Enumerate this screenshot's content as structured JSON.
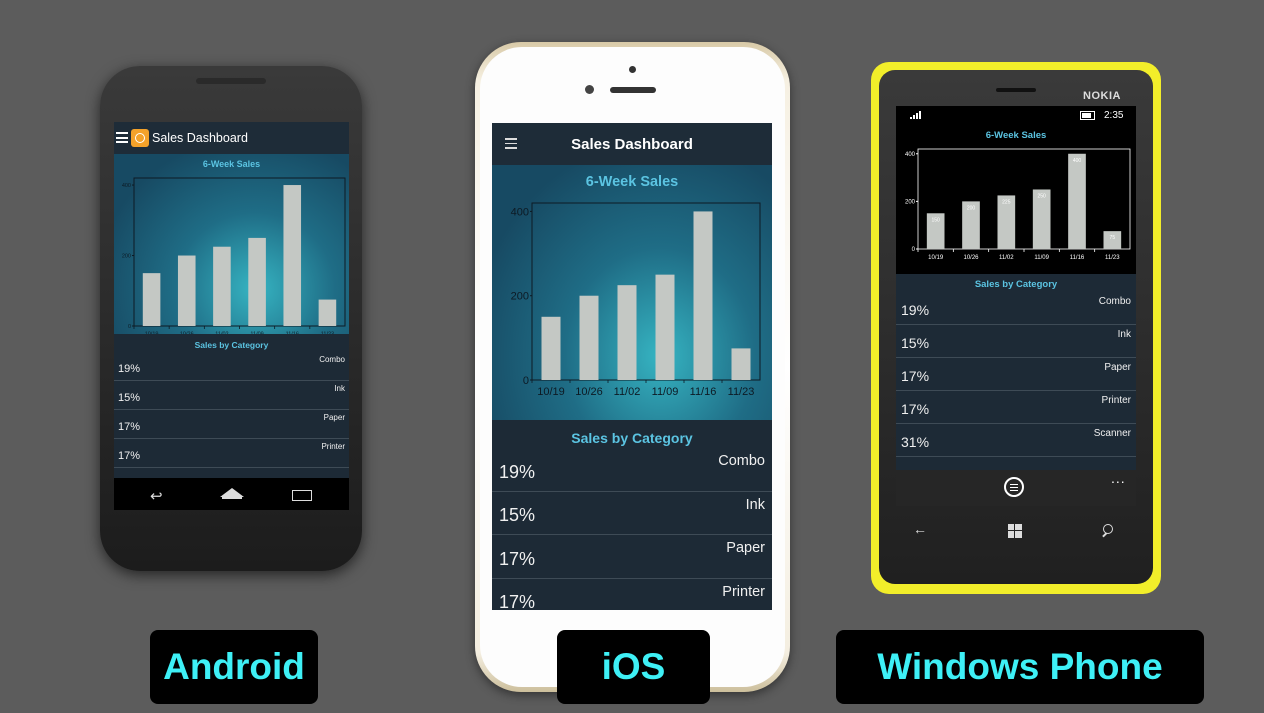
{
  "app": {
    "title": "Sales Dashboard"
  },
  "chart_data": {
    "type": "bar",
    "title": "6-Week Sales",
    "categories": [
      "10/19",
      "10/26",
      "11/02",
      "11/09",
      "11/16",
      "11/23"
    ],
    "values": [
      150,
      200,
      225,
      250,
      400,
      75
    ],
    "ylim": [
      0,
      420
    ],
    "yticks": [
      0,
      200,
      400
    ]
  },
  "category_section": {
    "title": "Sales by Category"
  },
  "categories": [
    {
      "pct": "19%",
      "name": "Combo"
    },
    {
      "pct": "15%",
      "name": "Ink"
    },
    {
      "pct": "17%",
      "name": "Paper"
    },
    {
      "pct": "17%",
      "name": "Printer"
    },
    {
      "pct": "31%",
      "name": "Scanner"
    }
  ],
  "windows_phone": {
    "brand": "NOKIA",
    "time": "2:35",
    "more": "..."
  },
  "labels": {
    "android": "Android",
    "ios": "iOS",
    "windows": "Windows Phone"
  },
  "colors": {
    "screen_bg": "#1d2a36",
    "accent_cyan": "#5bc4e2",
    "bar": "#c4c8c4",
    "label_text": "#3ef0f6",
    "wp_frame": "#f2ee2a"
  }
}
